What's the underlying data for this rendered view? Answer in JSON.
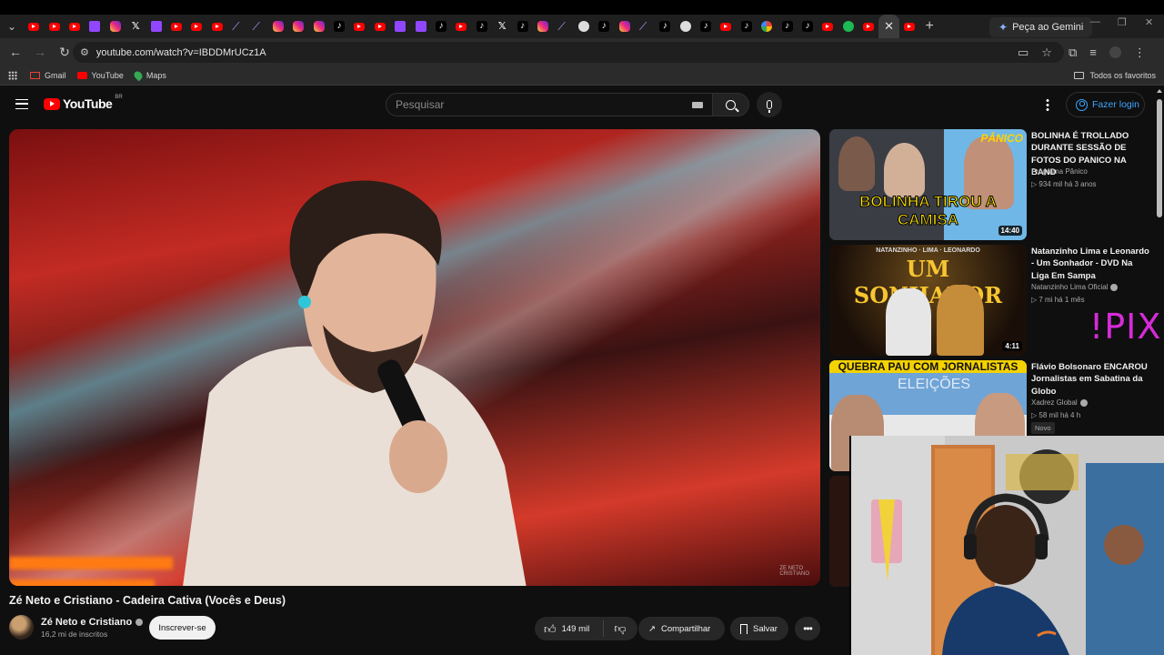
{
  "browser": {
    "tabs": [
      {
        "icon": "youtube-icon",
        "kind": "yt"
      },
      {
        "icon": "youtube-icon",
        "kind": "yt"
      },
      {
        "icon": "youtube-icon",
        "kind": "yt"
      },
      {
        "icon": "twitch-icon",
        "kind": "tw"
      },
      {
        "icon": "instagram-icon",
        "kind": "ig"
      },
      {
        "icon": "x-icon",
        "kind": "x"
      },
      {
        "icon": "twitch-icon",
        "kind": "tw"
      },
      {
        "icon": "youtube-icon",
        "kind": "yt"
      },
      {
        "icon": "youtube-icon",
        "kind": "yt"
      },
      {
        "icon": "youtube-icon",
        "kind": "yt"
      },
      {
        "icon": "feather-icon",
        "kind": "feather"
      },
      {
        "icon": "feather-icon",
        "kind": "feather"
      },
      {
        "icon": "instagram-icon",
        "kind": "ig"
      },
      {
        "icon": "instagram-icon",
        "kind": "ig"
      },
      {
        "icon": "instagram-icon",
        "kind": "ig"
      },
      {
        "icon": "tiktok-icon",
        "kind": "tk"
      },
      {
        "icon": "youtube-icon",
        "kind": "yt"
      },
      {
        "icon": "youtube-icon",
        "kind": "yt"
      },
      {
        "icon": "twitch-icon",
        "kind": "tw"
      },
      {
        "icon": "twitch-icon",
        "kind": "tw"
      },
      {
        "icon": "tiktok-icon",
        "kind": "tk"
      },
      {
        "icon": "youtube-icon",
        "kind": "yt"
      },
      {
        "icon": "tiktok-icon",
        "kind": "tk"
      },
      {
        "icon": "x-icon",
        "kind": "x"
      },
      {
        "icon": "tiktok-icon",
        "kind": "tk"
      },
      {
        "icon": "instagram-icon",
        "kind": "ig"
      },
      {
        "icon": "feather-icon",
        "kind": "feather"
      },
      {
        "icon": "github-icon",
        "kind": "gh"
      },
      {
        "icon": "tiktok-icon",
        "kind": "tk"
      },
      {
        "icon": "instagram-icon",
        "kind": "ig"
      },
      {
        "icon": "feather-icon",
        "kind": "feather"
      },
      {
        "icon": "tiktok-icon",
        "kind": "tk"
      },
      {
        "icon": "github-icon",
        "kind": "gh"
      },
      {
        "icon": "tiktok-icon",
        "kind": "tk"
      },
      {
        "icon": "youtube-icon",
        "kind": "yt"
      },
      {
        "icon": "tiktok-icon",
        "kind": "tk"
      },
      {
        "icon": "google-icon",
        "kind": "gg"
      },
      {
        "icon": "tiktok-icon",
        "kind": "tk"
      },
      {
        "icon": "tiktok-icon",
        "kind": "tk"
      },
      {
        "icon": "youtube-icon",
        "kind": "yt"
      },
      {
        "icon": "spotify-icon",
        "kind": "sp"
      },
      {
        "icon": "youtube-icon",
        "kind": "yt"
      },
      {
        "icon": "close-icon",
        "kind": "close",
        "active": true
      },
      {
        "icon": "youtube-icon",
        "kind": "yt"
      }
    ],
    "gemini_label": "Peça ao Gemini",
    "url": "youtube.com/watch?v=IBDDMrUCz1A",
    "bookmarks": [
      {
        "label": "Gmail",
        "icon": "gmail-icon"
      },
      {
        "label": "YouTube",
        "icon": "youtube-icon"
      },
      {
        "label": "Maps",
        "icon": "maps-icon"
      }
    ],
    "all_favorites": "Todos os favoritos"
  },
  "header": {
    "logo_text": "YouTube",
    "country_code": "BR",
    "search_placeholder": "Pesquisar",
    "login_label": "Fazer login"
  },
  "video": {
    "title": "Zé Neto e Cristiano - Cadeira Cativa (Vocês e Deus)",
    "channel": "Zé Neto e Cristiano",
    "subscribers": "16,2 mi de inscritos",
    "subscribe_label": "Inscrever-se",
    "likes": "149 mil",
    "share_label": "Compartilhar",
    "save_label": "Salvar"
  },
  "recommendations": [
    {
      "title": "BOLINHA É TROLLADO DURANTE SESSÃO DE FOTOS DO PANICO NA BAND",
      "channel": "Programa Pânico",
      "meta": "934 mil  há 3 anos",
      "duration": "14:40",
      "thumb_caption": "BOLINHA TIROU A CAMISA",
      "thumb_brand": "PÂNICO",
      "verified": false
    },
    {
      "title": "Natanzinho Lima e Leonardo - Um Sonhador - DVD Na Liga Em Sampa",
      "channel": "Natanzinho Lima Oficial",
      "meta": "7 mi  há 1 mês",
      "duration": "4:11",
      "thumb_caption": "UM SONHADOR",
      "thumb_top": "NATANZINHO · LIMA · LEONARDO",
      "verified": true
    },
    {
      "title": "Flávio Bolsonaro ENCAROU Jornalistas em Sabatina da Globo",
      "channel": "Xadrez Global",
      "meta": "58 mil  há 4 h",
      "badge": "Novo",
      "thumb_caption": "QUEBRA PAU COM JORNALISTAS",
      "thumb_sub": "ELEIÇÕES",
      "verified": true
    }
  ],
  "overlay_text": "!PIX"
}
